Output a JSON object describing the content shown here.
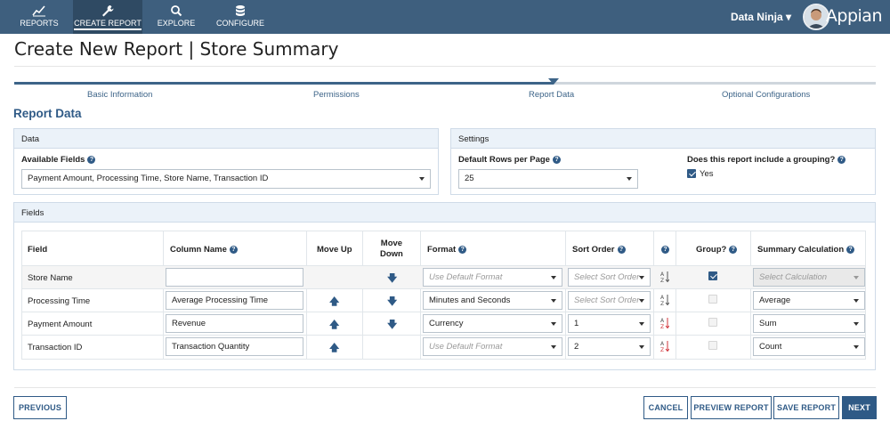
{
  "nav": {
    "items": [
      {
        "label": "REPORTS",
        "icon": "chart-line-icon"
      },
      {
        "label": "CREATE REPORT",
        "icon": "wrench-icon"
      },
      {
        "label": "EXPLORE",
        "icon": "search-icon"
      },
      {
        "label": "CONFIGURE",
        "icon": "database-icon"
      }
    ],
    "active": "CREATE REPORT",
    "user_name": "Data Ninja ▾",
    "logo": "Appian"
  },
  "page_title": "Create New Report | Store Summary",
  "wizard": {
    "steps": [
      "Basic Information",
      "Permissions",
      "Report Data",
      "Optional Configurations"
    ],
    "current_step": "Report Data"
  },
  "section_heading": "Report Data",
  "data_box": {
    "header": "Data",
    "available_fields_label": "Available Fields",
    "available_fields_value": "Payment Amount, Processing Time, Store Name, Transaction ID"
  },
  "settings_box": {
    "header": "Settings",
    "rows_label": "Default Rows per Page",
    "rows_value": "25",
    "grouping_label": "Does this report include a grouping?",
    "grouping_option": "Yes",
    "grouping_checked": true
  },
  "fields_box": {
    "header": "Fields",
    "columns": {
      "field": "Field",
      "column_name": "Column Name",
      "move_up": "Move Up",
      "move_down_1": "Move",
      "move_down_2": "Down",
      "format": "Format",
      "sort_order": "Sort Order",
      "group": "Group?",
      "summary": "Summary Calculation"
    },
    "rows": [
      {
        "field": "Store Name",
        "column_name": "",
        "move_up": false,
        "move_down": true,
        "format": "Use Default Format",
        "format_placeholder": true,
        "sort": "Select Sort Order",
        "sort_placeholder": true,
        "sort_dir": "asc",
        "group": true,
        "summary": "Select Calculation",
        "summary_disabled": true
      },
      {
        "field": "Processing Time",
        "column_name": "Average Processing Time",
        "move_up": true,
        "move_down": true,
        "format": "Minutes and Seconds",
        "format_placeholder": false,
        "sort": "Select Sort Order",
        "sort_placeholder": true,
        "sort_dir": "asc",
        "group": false,
        "summary": "Average",
        "summary_disabled": false
      },
      {
        "field": "Payment Amount",
        "column_name": "Revenue",
        "move_up": true,
        "move_down": true,
        "format": "Currency",
        "format_placeholder": false,
        "sort": "1",
        "sort_placeholder": false,
        "sort_dir": "desc",
        "group": false,
        "summary": "Sum",
        "summary_disabled": false
      },
      {
        "field": "Transaction ID",
        "column_name": "Transaction Quantity",
        "move_up": true,
        "move_down": false,
        "format": "Use Default Format",
        "format_placeholder": true,
        "sort": "2",
        "sort_placeholder": false,
        "sort_dir": "desc",
        "group": false,
        "summary": "Count",
        "summary_disabled": false
      }
    ]
  },
  "buttons": {
    "previous": "PREVIOUS",
    "cancel": "CANCEL",
    "preview": "PREVIEW REPORT",
    "save": "SAVE REPORT",
    "next": "NEXT"
  },
  "colors": {
    "nav_bg": "#3e5f7e",
    "accent": "#2f5a86",
    "sort_desc_red": "#d0343b"
  }
}
